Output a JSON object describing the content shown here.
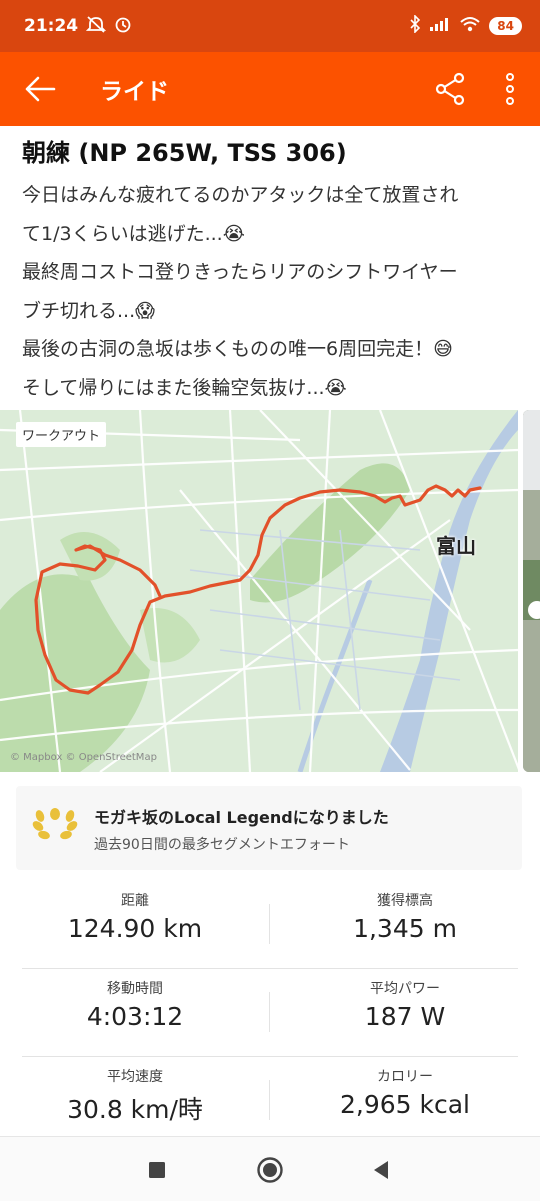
{
  "status": {
    "time": "21:24",
    "battery": "84"
  },
  "appbar": {
    "title": "ライド"
  },
  "activity": {
    "title": "朝練 (NP 265W, TSS 306)",
    "lines": [
      "今日はみんな疲れてるのかアタックは全て放置され",
      "て1/3くらいは逃げた...😭",
      "最終周コストコ登りきったらリアのシフトワイヤー",
      "ブチ切れる...😱",
      "最後の古洞の急坂は歩くものの唯一6周回完走！😅",
      "そして帰りにはまた後輪空気抜け...😭"
    ]
  },
  "map": {
    "badge": "ワークアウト",
    "city": "富山",
    "attribution": "© Mapbox © OpenStreetMap"
  },
  "achievement": {
    "headline": "モガキ坂のLocal Legendになりました",
    "sub": "過去90日間の最多セグメントエフォート"
  },
  "stats": [
    {
      "label": "距離",
      "value": "124.90 km"
    },
    {
      "label": "獲得標高",
      "value": "1,345 m"
    },
    {
      "label": "移動時間",
      "value": "4:03:12"
    },
    {
      "label": "平均パワー",
      "value": "187 W"
    },
    {
      "label": "平均速度",
      "value": "30.8 km/時"
    },
    {
      "label": "カロリー",
      "value": "2,965 kcal"
    }
  ],
  "colors": {
    "brand": "#fc5200",
    "statusbar": "#d9460f",
    "route": "#e2512a",
    "map_green": "#b5d9a6",
    "river": "#b8c9e0"
  },
  "icons": [
    "back-arrow-icon",
    "share-icon",
    "more-icon",
    "laurel-icon",
    "stop-icon",
    "home-icon",
    "back-triangle-icon"
  ]
}
